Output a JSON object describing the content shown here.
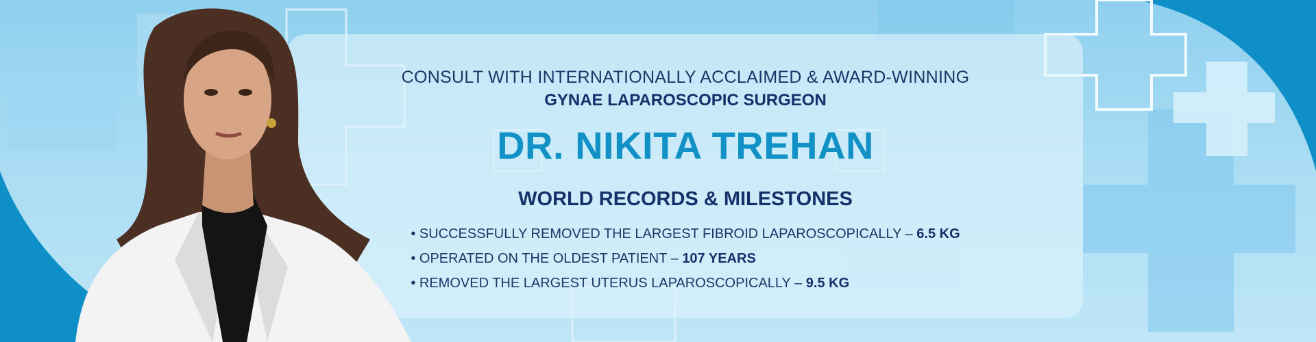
{
  "hero": {
    "intro": "CONSULT WITH INTERNATIONALLY ACCLAIMED & AWARD-WINNING",
    "subtitle": "GYNAE LAPAROSCOPIC SURGEON",
    "name": "DR. NIKITA TREHAN",
    "section_title": "WORLD RECORDS & MILESTONES",
    "milestones": [
      {
        "text": "SUCCESSFULLY REMOVED THE LARGEST FIBROID LAPAROSCOPICALLY – ",
        "highlight": "6.5 KG"
      },
      {
        "text": "OPERATED ON THE OLDEST PATIENT – ",
        "highlight": "107 YEARS"
      },
      {
        "text": "REMOVED THE LARGEST UTERUS LAPAROSCOPICALLY – ",
        "highlight": "9.5 KG"
      }
    ]
  },
  "colors": {
    "accent_blue": "#1191c6",
    "navy_text": "#16306a",
    "corner_blue": "#0e8fc8",
    "background_light": "#bfe6f7"
  },
  "icons": [
    "medical-cross-icon",
    "doctor-portrait"
  ]
}
